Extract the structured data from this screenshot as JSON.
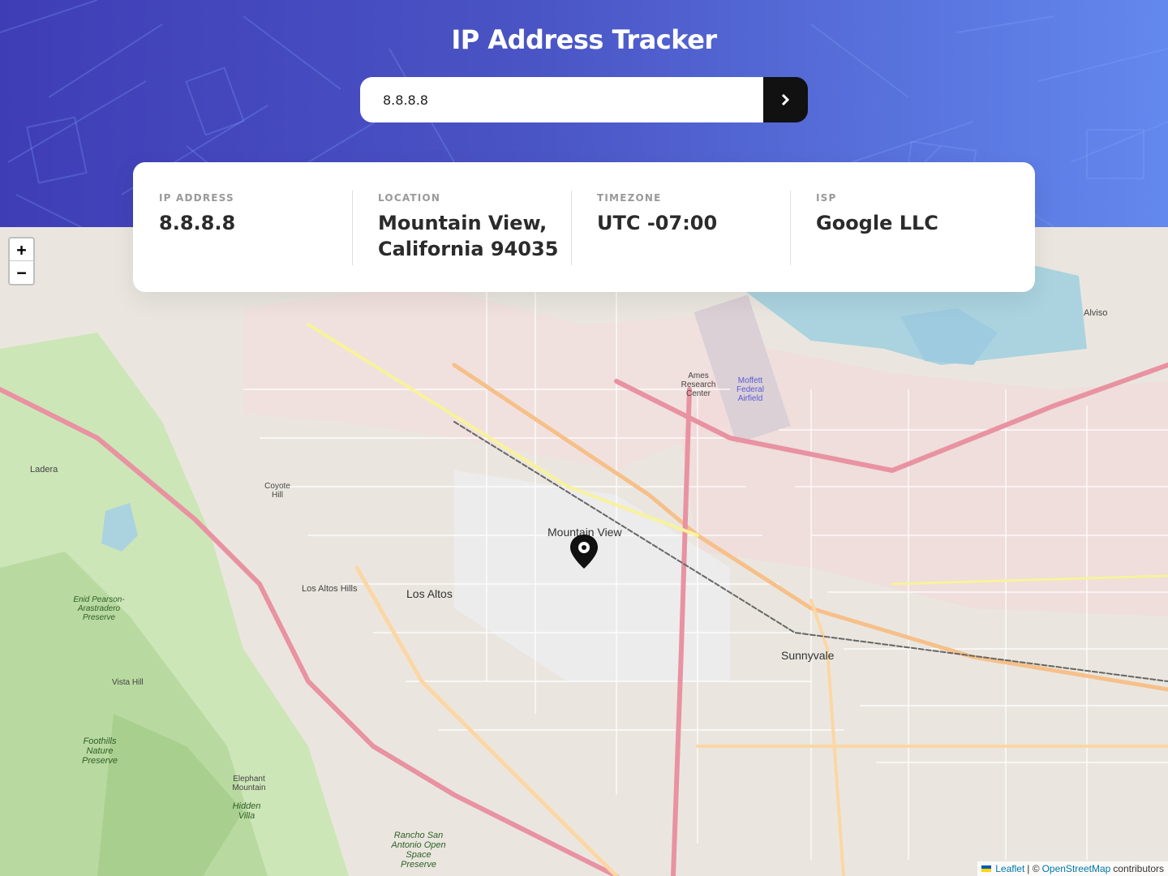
{
  "header": {
    "title": "IP Address Tracker",
    "search_value": "8.8.8.8",
    "search_icon": "chevron-right-icon"
  },
  "stats": [
    {
      "label": "IP ADDRESS",
      "value": "8.8.8.8"
    },
    {
      "label": "LOCATION",
      "value": "Mountain View, California 94035"
    },
    {
      "label": "TIMEZONE",
      "value": "UTC -07:00"
    },
    {
      "label": "ISP",
      "value": "Google LLC"
    }
  ],
  "map": {
    "zoom_in": "+",
    "zoom_out": "−",
    "marker_icon": "location-pin-icon",
    "labels": {
      "mountain_view": "Mountain View",
      "los_altos": "Los Altos",
      "los_altos_hills": "Los Altos Hills",
      "sunnyvale": "Sunnyvale",
      "ladera": "Ladera",
      "alviso": "Alviso",
      "ames": "Ames Research Center",
      "moffett": "Moffett Federal Airfield",
      "coyote_hill": "Coyote Hill",
      "foothills": "Foothills Nature Preserve",
      "hidden_villa": "Hidden Villa",
      "rancho": "Rancho San Antonio Open Space Preserve",
      "vista_hill": "Vista Hill",
      "enid": "Enid Pearson-Arastradero Preserve",
      "elephant": "Elephant Mountain"
    },
    "attribution": {
      "leaflet": "Leaflet",
      "separator": "| ©",
      "osm": "OpenStreetMap",
      "suffix": "contributors"
    }
  },
  "colors": {
    "header_start": "#3f3db6",
    "header_end": "#6388ee",
    "button": "#111111"
  }
}
